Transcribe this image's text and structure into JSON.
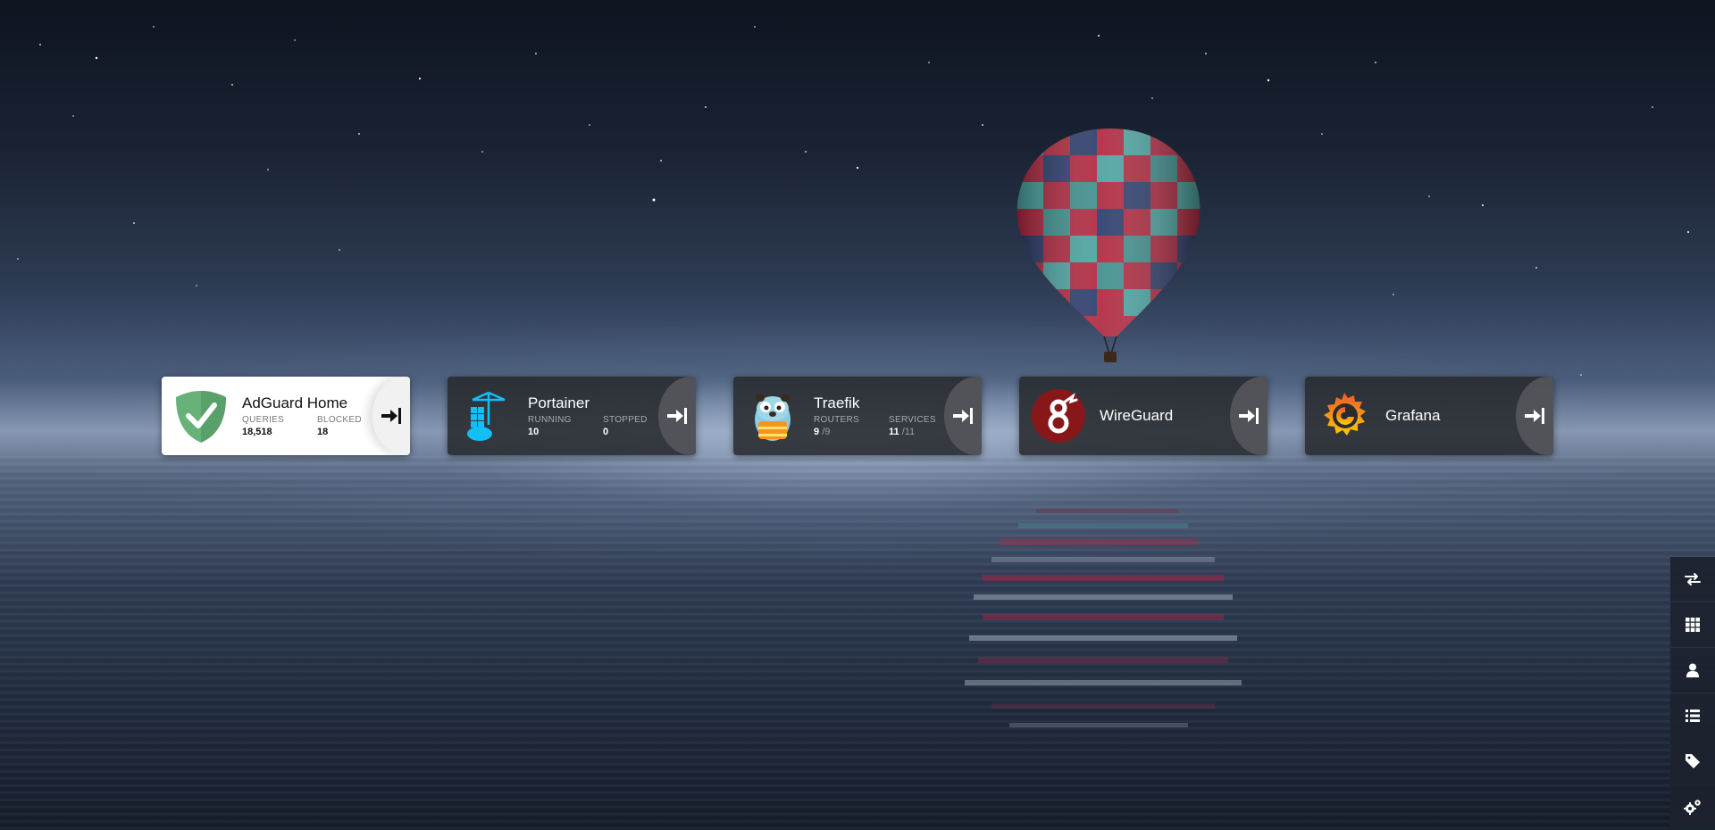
{
  "apps": [
    {
      "name": "AdGuard Home",
      "stats": [
        {
          "label": "QUERIES",
          "value": "18,518"
        },
        {
          "label": "BLOCKED",
          "value": "18"
        }
      ]
    },
    {
      "name": "Portainer",
      "stats": [
        {
          "label": "RUNNING",
          "value": "10"
        },
        {
          "label": "STOPPED",
          "value": "0"
        }
      ]
    },
    {
      "name": "Traefik",
      "stats": [
        {
          "label": "ROUTERS",
          "value": "9",
          "sub": "/9"
        },
        {
          "label": "SERVICES",
          "value": "11",
          "sub": "/11"
        }
      ]
    },
    {
      "name": "WireGuard"
    },
    {
      "name": "Grafana"
    }
  ],
  "sidebar": [
    "swap-icon",
    "grid-icon",
    "user-icon",
    "list-icon",
    "tag-icon",
    "settings-icon"
  ],
  "colors": {
    "card_dark": "#28292e",
    "card_light": "#ffffff",
    "adguard_green": "#67b279",
    "portainer_blue": "#13bef9",
    "wireguard_red": "#88171a",
    "grafana_orange": "#f46800"
  }
}
